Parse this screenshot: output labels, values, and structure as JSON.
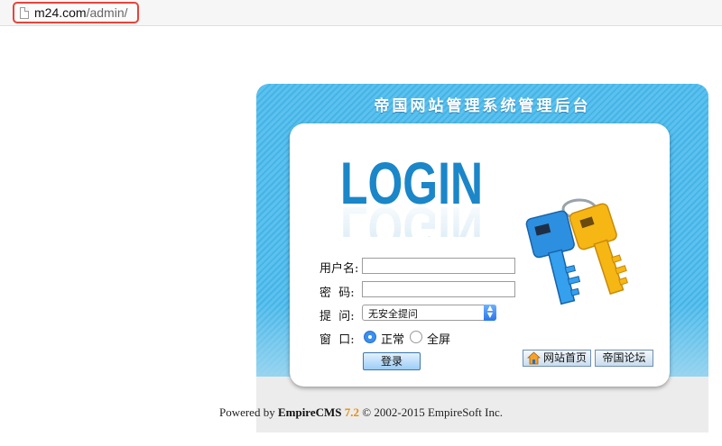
{
  "browser": {
    "url_host": "m24.com",
    "url_path": "/admin/"
  },
  "panel": {
    "title": "帝国网站管理系统管理后台",
    "logo_text": "LOGIN"
  },
  "form": {
    "username_label": "用户名:",
    "username_value": "",
    "password_label": "密  码:",
    "password_value": "",
    "hint_label": "提  问:",
    "hint_selected": "无安全提问",
    "window_label": "窗  口:",
    "window_options": [
      {
        "label": "正常",
        "selected": true
      },
      {
        "label": "全屏",
        "selected": false
      }
    ],
    "submit_label": "登录"
  },
  "links": {
    "home_label": "网站首页",
    "forum_label": "帝国论坛"
  },
  "footer": {
    "prefix": "Powered by ",
    "product": "EmpireCMS",
    "version": "7.2",
    "copyright": "© 2002-2015 EmpireSoft Inc."
  },
  "colors": {
    "panel_blue": "#45b4e6",
    "logo_blue": "#1b86c8",
    "highlight_red": "#e8433a",
    "version_orange": "#e98b0a"
  },
  "icons": [
    "page-icon",
    "home-icon",
    "keys-icon",
    "chevron-updown-icon"
  ]
}
